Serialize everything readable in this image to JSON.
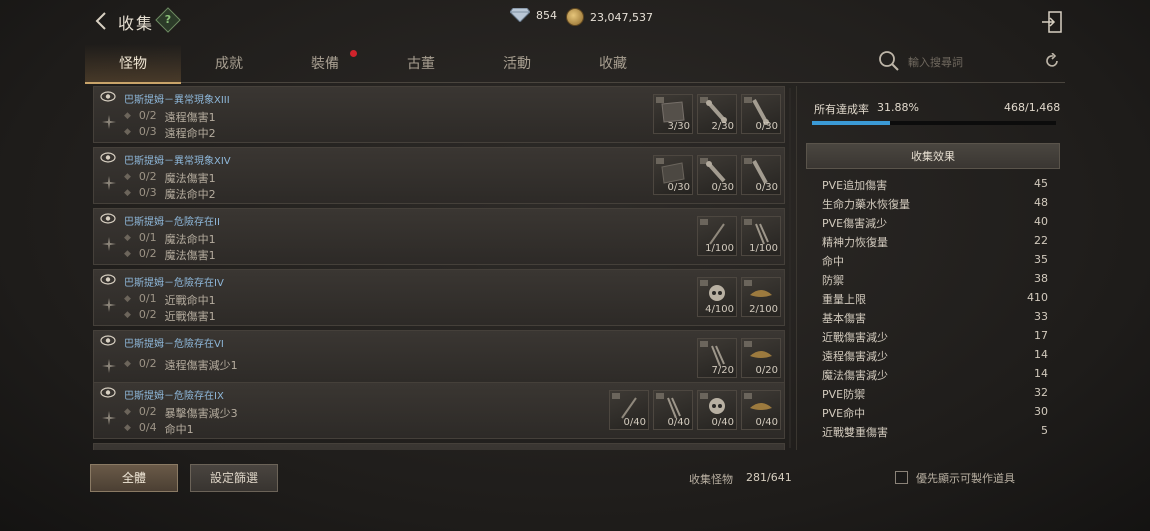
{
  "header": {
    "title": "收集",
    "help_symbol": "?",
    "diamonds": "854",
    "gold": "23,047,537"
  },
  "tabs": [
    {
      "label": "怪物",
      "active": true
    },
    {
      "label": "成就",
      "active": false
    },
    {
      "label": "裝備",
      "active": false,
      "badge": true
    },
    {
      "label": "古董",
      "active": false
    },
    {
      "label": "活動",
      "active": false
    },
    {
      "label": "收藏",
      "active": false
    }
  ],
  "search": {
    "placeholder": "輸入搜尋詞"
  },
  "rows": [
    {
      "title": "巴斯提姆－異常現象XIII",
      "stats": [
        {
          "count": "0/2",
          "name": "遠程傷害1"
        },
        {
          "count": "0/3",
          "name": "遠程命中2"
        }
      ],
      "slots": [
        "3/30",
        "2/30",
        "0/30"
      ]
    },
    {
      "title": "巴斯提姆－異常現象XIV",
      "stats": [
        {
          "count": "0/2",
          "name": "魔法傷害1"
        },
        {
          "count": "0/3",
          "name": "魔法命中2"
        }
      ],
      "slots": [
        "0/30",
        "0/30",
        "0/30"
      ]
    },
    {
      "title": "巴斯提姆－危險存在II",
      "stats": [
        {
          "count": "0/1",
          "name": "魔法命中1"
        },
        {
          "count": "0/2",
          "name": "魔法傷害1"
        }
      ],
      "slots": [
        "1/100",
        "1/100"
      ]
    },
    {
      "title": "巴斯提姆－危險存在IV",
      "stats": [
        {
          "count": "0/1",
          "name": "近戰命中1"
        },
        {
          "count": "0/2",
          "name": "近戰傷害1"
        }
      ],
      "slots": [
        "4/100",
        "2/100"
      ]
    },
    {
      "title": "巴斯提姆－危險存在VI",
      "stats": [
        {
          "count": "0/2",
          "name": "遠程傷害減少1"
        }
      ],
      "slots": [
        "7/20",
        "0/20"
      ]
    },
    {
      "title": "巴斯提姆－危險存在IX",
      "stats": [
        {
          "count": "0/2",
          "name": "暴擊傷害減少3"
        },
        {
          "count": "0/4",
          "name": "命中1"
        }
      ],
      "slots": [
        "0/40",
        "0/40",
        "0/40",
        "0/40"
      ]
    }
  ],
  "summary": {
    "label": "所有達成率",
    "percent": "31.88%",
    "fraction": 0.3188,
    "count": "468/1,468"
  },
  "effects_title": "收集效果",
  "effects": [
    {
      "name": "PVE追加傷害",
      "value": "45"
    },
    {
      "name": "生命力藥水恢復量",
      "value": "48"
    },
    {
      "name": "PVE傷害減少",
      "value": "40"
    },
    {
      "name": "精神力恢復量",
      "value": "22"
    },
    {
      "name": "命中",
      "value": "35"
    },
    {
      "name": "防禦",
      "value": "38"
    },
    {
      "name": "重量上限",
      "value": "410"
    },
    {
      "name": "基本傷害",
      "value": "33"
    },
    {
      "name": "近戰傷害減少",
      "value": "17"
    },
    {
      "name": "遠程傷害減少",
      "value": "14"
    },
    {
      "name": "魔法傷害減少",
      "value": "14"
    },
    {
      "name": "PVE防禦",
      "value": "32"
    },
    {
      "name": "PVE命中",
      "value": "30"
    },
    {
      "name": "近戰雙重傷害",
      "value": "5"
    }
  ],
  "footer": {
    "all_button": "全體",
    "filter_button": "設定篩選",
    "collect_label": "收集怪物",
    "collect_count": "281/641",
    "checkbox_label": "優先顯示可製作道具"
  }
}
